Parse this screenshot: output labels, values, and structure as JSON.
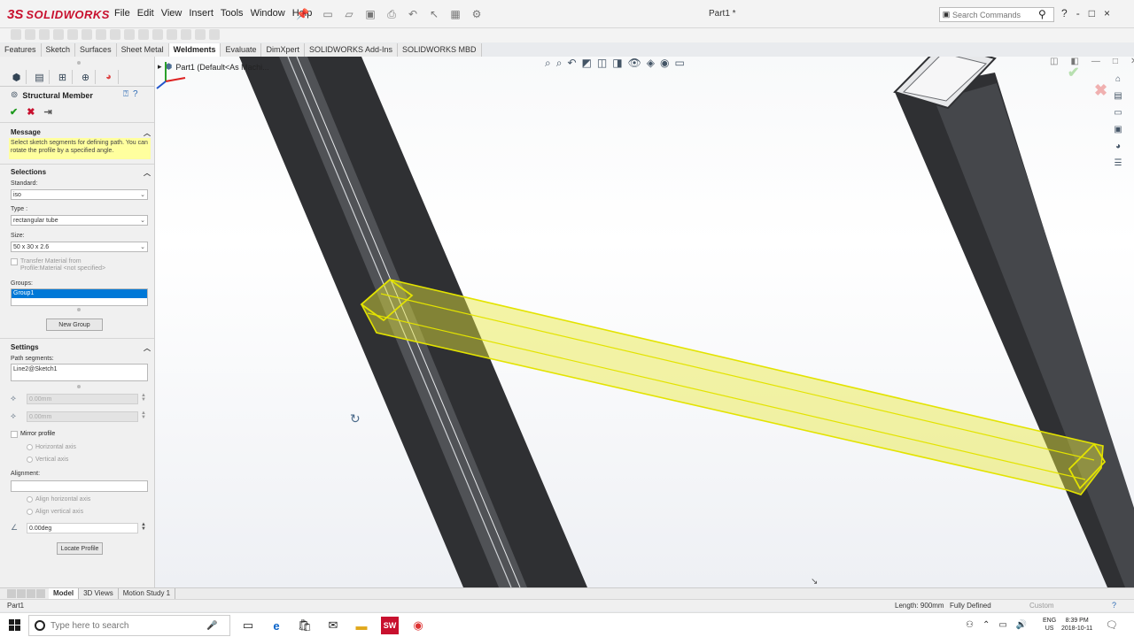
{
  "app": {
    "brand_ds": "3S",
    "brand_name": "SOLIDWORKS",
    "document_title": "Part1 *",
    "menus": [
      "File",
      "Edit",
      "View",
      "Insert",
      "Tools",
      "Window",
      "Help"
    ],
    "search_placeholder": "Search Commands",
    "window_controls": [
      "?",
      "-",
      "□",
      "×"
    ]
  },
  "command_tabs": [
    "Features",
    "Sketch",
    "Surfaces",
    "Sheet Metal",
    "Weldments",
    "Evaluate",
    "DimXpert",
    "SOLIDWORKS Add-Ins",
    "SOLIDWORKS MBD"
  ],
  "command_tabs_active": "Weldments",
  "tree": {
    "flyout_text": "Part1  (Default<As Machi..."
  },
  "property_manager": {
    "title": "Structural Member",
    "message_section": "Message",
    "message_text": "Select sketch segments for defining path. You can rotate the profile by a specified angle.",
    "selections_section": "Selections",
    "standard_label": "Standard:",
    "standard_value": "iso",
    "type_label": "Type :",
    "type_value": "rectangular tube",
    "size_label": "Size:",
    "size_value": "50 x 30 x 2.6",
    "transfer_material_line1": "Transfer Material from",
    "transfer_material_line2": "Profile:Material <not specified>",
    "groups_label": "Groups:",
    "group_item": "Group1",
    "new_group_button": "New Group",
    "settings_section": "Settings",
    "path_segments_label": "Path segments:",
    "path_segment_value": "Line2@Sketch1",
    "offset1_value": "0.00mm",
    "offset2_value": "0.00mm",
    "mirror_profile_label": "Mirror profile",
    "horizontal_axis_label": "Horizontal axis",
    "vertical_axis_label": "Vertical axis",
    "alignment_label": "Alignment:",
    "align_horizontal_label": "Align horizontal axis",
    "align_vertical_label": "Align vertical axis",
    "rotation_value": "0.00deg",
    "locate_profile_button": "Locate Profile"
  },
  "bottom_tabs": [
    "Model",
    "3D Views",
    "Motion Study 1"
  ],
  "bottom_tabs_active": "Model",
  "status": {
    "left": "Part1",
    "length": "Length: 900mm",
    "state": "Fully Defined",
    "units": "Custom"
  },
  "taskbar": {
    "search_placeholder": "Type here to search",
    "lang_top": "ENG",
    "lang_bottom": "US",
    "time": "8:39 PM",
    "date": "2018-10-11"
  },
  "colors": {
    "highlight": "#ffff00",
    "brand": "#c8102e",
    "selection": "#0078d7"
  }
}
